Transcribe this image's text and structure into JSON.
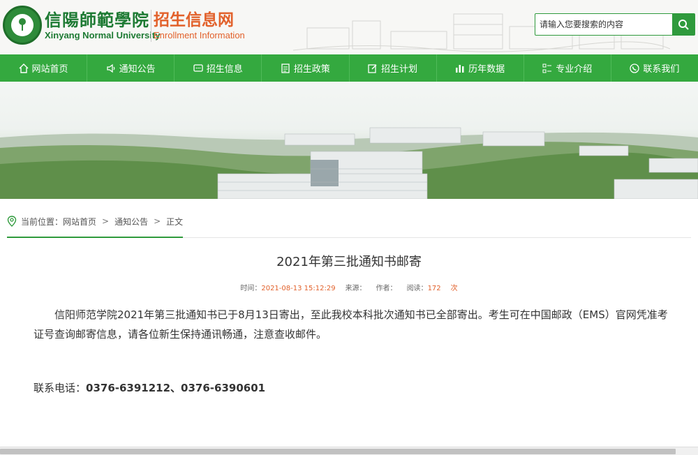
{
  "header": {
    "school_cn": "信陽師範學院",
    "school_en": "Xinyang Normal University",
    "system_cn": "招生信息网",
    "system_en": "Enrollment Information",
    "search_placeholder": "请输入您要搜索的内容",
    "search_icon": "search-icon"
  },
  "nav": {
    "items": [
      {
        "label": "网站首页",
        "icon": "home-icon"
      },
      {
        "label": "通知公告",
        "icon": "speaker-icon"
      },
      {
        "label": "招生信息",
        "icon": "chat-icon"
      },
      {
        "label": "招生政策",
        "icon": "document-icon"
      },
      {
        "label": "招生计划",
        "icon": "edit-icon"
      },
      {
        "label": "历年数据",
        "icon": "bar-chart-icon"
      },
      {
        "label": "专业介绍",
        "icon": "list-icon"
      },
      {
        "label": "联系我们",
        "icon": "phone-icon"
      }
    ]
  },
  "breadcrumb": {
    "prefix": "当前位置：",
    "items": [
      "网站首页",
      "通知公告",
      "正文"
    ],
    "separator": ">"
  },
  "article": {
    "title": "2021年第三批通知书邮寄",
    "meta": {
      "time_label": "时间：",
      "time_value": "2021-08-13 15:12:29",
      "source_label": "来源：",
      "author_label": "作者：",
      "views_label": "阅读：",
      "views_value": "172",
      "views_unit": "次"
    },
    "body": "信阳师范学院2021年第三批通知书已于8月13日寄出，至此我校本科批次通知书已全部寄出。考生可在中国邮政（EMS）官网凭准考证号查询邮寄信息，请各位新生保持通讯畅通，注意查收邮件。",
    "phone_label": "联系电话：",
    "phone_value": "0376-6391212、0376-6390601"
  },
  "colors": {
    "green": "#34a93f",
    "dark_green": "#1d7a33",
    "orange": "#e2612b"
  }
}
